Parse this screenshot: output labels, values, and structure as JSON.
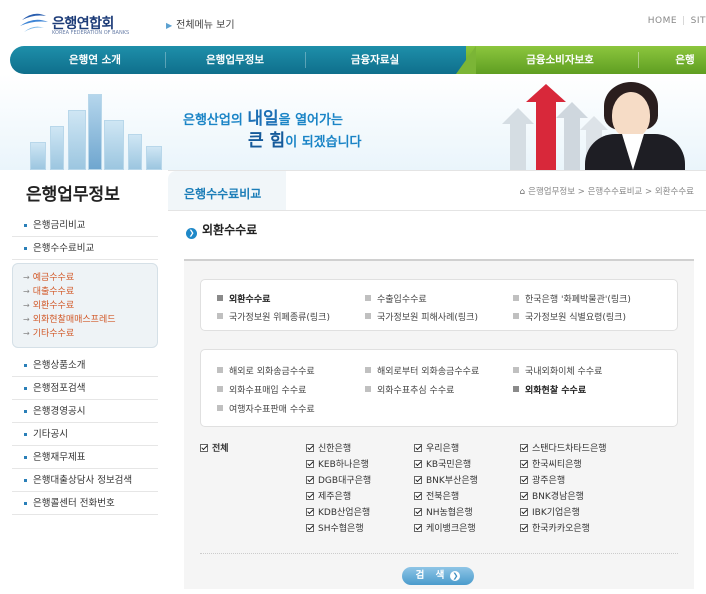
{
  "header": {
    "logo_text": "은행연합회",
    "logo_sub": "KOREA FEDERATION OF BANKS",
    "all_menu": "전체메뉴 보기",
    "util": [
      "HOME",
      "SIT"
    ]
  },
  "gnb": {
    "items": [
      "은행연 소개",
      "은행업무정보",
      "금융자료실",
      "금융소비자보호",
      "은행"
    ]
  },
  "banner": {
    "line1_a": "은행산업의 ",
    "line1_b": "내일",
    "line1_c": "을 열어가는",
    "line2_a": "큰 힘",
    "line2_b": "이 되겠습니다"
  },
  "sidebar": {
    "title": "은행업무정보",
    "items_top": [
      "은행금리비교",
      "은행수수료비교"
    ],
    "sub_items": [
      "예금수수료",
      "대출수수료",
      "외환수수료",
      "외화현찰매매스프레드",
      "기타수수료"
    ],
    "items_bottom": [
      "은행상품소개",
      "은행점포검색",
      "은행경영공시",
      "기타공시",
      "은행재무제표",
      "은행대출상담사 정보검색",
      "은행콜센터 전화번호"
    ]
  },
  "content": {
    "title": "은행수수료비교",
    "breadcrumb": [
      "은행업무정보",
      "은행수수료비교",
      "외환수수료"
    ],
    "section_title": "외환수수료"
  },
  "options_group1": [
    {
      "label": "외환수수료",
      "selected": true
    },
    {
      "label": "수출입수수료",
      "selected": false
    },
    {
      "label": "한국은행 '화폐박물관'(링크)",
      "selected": false
    },
    {
      "label": "국가정보원 위폐종류(링크)",
      "selected": false
    },
    {
      "label": "국가정보원 피해사례(링크)",
      "selected": false
    },
    {
      "label": "국가정보원 식별요령(링크)",
      "selected": false
    }
  ],
  "options_group2": [
    {
      "label": "해외로 외화송금수수료",
      "selected": false
    },
    {
      "label": "해외로부터 외화송금수수료",
      "selected": false
    },
    {
      "label": "국내외화이체 수수료",
      "selected": false
    },
    {
      "label": "외화수표매입 수수료",
      "selected": false
    },
    {
      "label": "외화수표추심 수수료",
      "selected": false
    },
    {
      "label": "외화현찰 수수료",
      "selected": true
    },
    {
      "label": "여행자수표판매 수수료",
      "selected": false
    }
  ],
  "banks": {
    "all_label": "전체",
    "list": [
      "신한은행",
      "우리은행",
      "스탠다드차타드은행",
      "KEB하나은행",
      "KB국민은행",
      "한국씨티은행",
      "DGB대구은행",
      "BNK부산은행",
      "광주은행",
      "제주은행",
      "전북은행",
      "BNK경남은행",
      "KDB산업은행",
      "NH농협은행",
      "IBK기업은행",
      "SH수협은행",
      "케이뱅크은행",
      "한국카카오은행"
    ]
  },
  "search_button": "검 색"
}
